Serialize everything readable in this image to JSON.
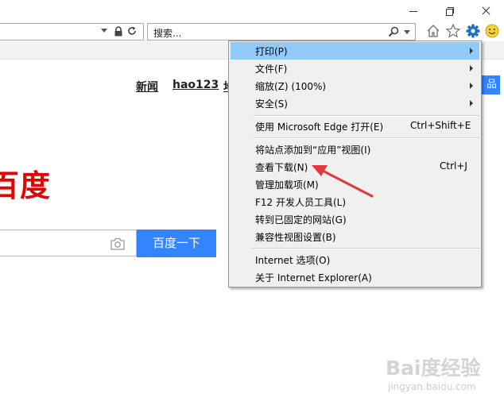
{
  "browser": {
    "search_placeholder": "搜索...",
    "icons": [
      "home-icon",
      "favorites-star-icon",
      "tools-gear-icon",
      "feedback-smiley-icon"
    ]
  },
  "page": {
    "top_links": [
      "新闻",
      "hao123",
      "地"
    ],
    "more_button": "品",
    "logo_text": "百度",
    "search_button": "百度一下"
  },
  "menu": {
    "items": [
      {
        "label": "打印(P)",
        "submenu": true,
        "highlighted": true
      },
      {
        "label": "文件(F)",
        "submenu": true
      },
      {
        "label": "缩放(Z) (100%)",
        "submenu": true
      },
      {
        "label": "安全(S)",
        "submenu": true
      },
      {
        "label": "使用 Microsoft Edge 打开(E)",
        "shortcut": "Ctrl+Shift+E"
      },
      {
        "label": "将站点添加到“应用”视图(I)"
      },
      {
        "label": "查看下载(N)",
        "shortcut": "Ctrl+J"
      },
      {
        "label": "管理加载项(M)"
      },
      {
        "label": "F12 开发人员工具(L)"
      },
      {
        "label": "转到已固定的网站(G)"
      },
      {
        "label": "兼容性视图设置(B)"
      },
      {
        "label": "Internet 选项(O)"
      },
      {
        "label": "关于 Internet Explorer(A)"
      }
    ]
  },
  "watermark": {
    "brand": "Bai度经验",
    "url": "jingyan.baidu.com"
  },
  "colors": {
    "highlight": "#91c9f7",
    "baidu_blue": "#3385ff",
    "baidu_red": "#e10602",
    "annotation": "#e0383e"
  }
}
